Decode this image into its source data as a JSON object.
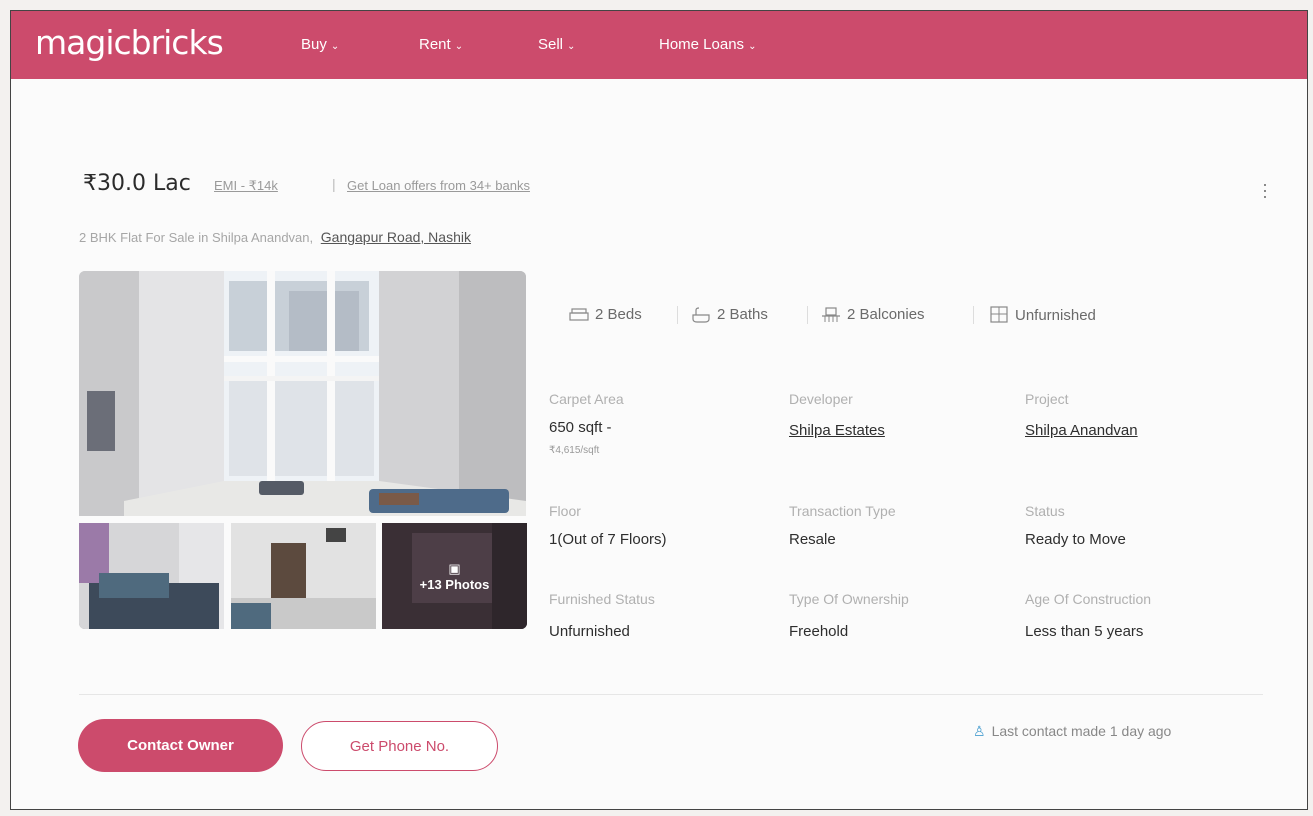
{
  "header": {
    "logo": "magicbricks",
    "nav": [
      {
        "label": "Buy"
      },
      {
        "label": "Rent"
      },
      {
        "label": "Sell"
      },
      {
        "label": "Home Loans"
      }
    ],
    "color": "#cc4b6c"
  },
  "listing": {
    "price": "₹30.0 Lac",
    "emi_link": "EMI - ₹14k",
    "loan_link": "Get Loan offers from 34+ banks",
    "subtitle": "2 BHK Flat For Sale in Shilpa Anandvan,",
    "location_link": "Gangapur Road, Nashik",
    "photos_more": "+13 Photos",
    "stats": [
      {
        "label": "2 Beds",
        "icon": "bed-icon"
      },
      {
        "label": "2 Baths",
        "icon": "bath-icon"
      },
      {
        "label": "2 Balconies",
        "icon": "balcony-icon"
      },
      {
        "label": "Unfurnished",
        "icon": "furnishing-icon"
      }
    ],
    "details": [
      {
        "label": "Carpet Area",
        "value": "650 sqft -",
        "sub": "₹4,615/sqft"
      },
      {
        "label": "Developer",
        "value": "Shilpa Estates"
      },
      {
        "label": "Project",
        "value": "Shilpa Anandvan"
      },
      {
        "label": "Floor",
        "value": "1(Out of 7 Floors)"
      },
      {
        "label": "Transaction Type",
        "value": "Resale"
      },
      {
        "label": "Status",
        "value": "Ready to Move"
      },
      {
        "label": "Furnished Status",
        "value": "Unfurnished"
      },
      {
        "label": "Type Of Ownership",
        "value": "Freehold"
      },
      {
        "label": "Age Of Construction",
        "value": "Less than 5 years"
      }
    ]
  },
  "actions": {
    "contact_owner": "Contact Owner",
    "get_phone": "Get Phone No.",
    "last_contact": "Last contact made 1 day ago"
  }
}
